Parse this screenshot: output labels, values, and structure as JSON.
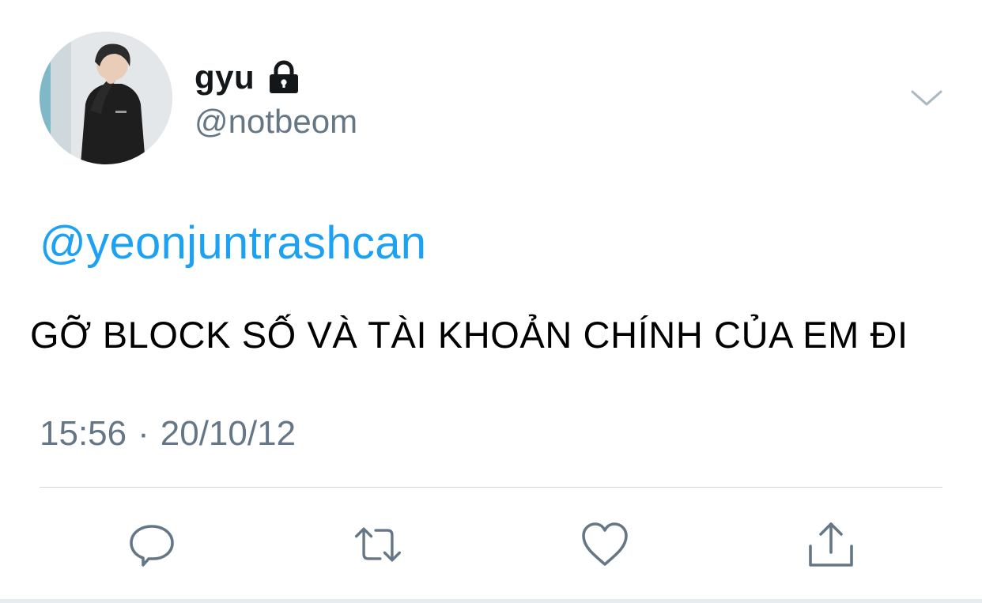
{
  "tweet": {
    "display_name": "gyu",
    "handle": "@notbeom",
    "mention": "@yeonjuntrashcan",
    "text": "GỠ BLOCK SỐ VÀ TÀI KHOẢN CHÍNH CỦA EM ĐI",
    "time": "15:56",
    "separator": "·",
    "date": "20/10/12"
  },
  "icons": {
    "lock": "lock-icon",
    "more": "chevron-down-icon",
    "reply": "reply-icon",
    "retweet": "retweet-icon",
    "like": "heart-icon",
    "share": "share-icon"
  },
  "colors": {
    "link": "#1da1f2",
    "secondary_text": "#657786",
    "icon": "#657786",
    "primary_text": "#14171a",
    "divider": "#ccd6dd"
  }
}
